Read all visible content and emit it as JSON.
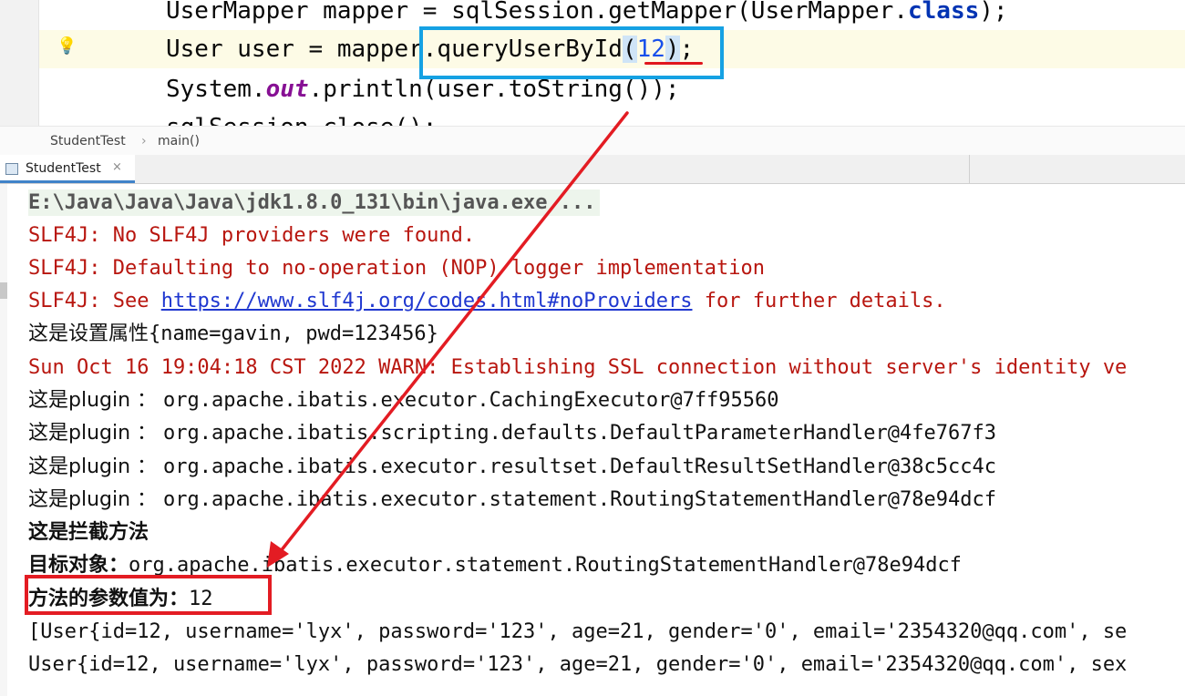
{
  "editor": {
    "line1": {
      "a": "UserMapper mapper = sqlSession.getMapper(UserMapper.",
      "kw": "class",
      "b": ");"
    },
    "line2": {
      "a": "User user = mapper.queryUserById",
      "open": "(",
      "num": "12",
      "close": ")",
      "b": ";"
    },
    "line3": {
      "a": "System.",
      "fld": "out",
      "b": ".println(user.toString());"
    },
    "line4": "sqlSession.close();"
  },
  "breadcrumb": {
    "class_name": "StudentTest",
    "separator": "›",
    "method": "main()"
  },
  "run_tab": {
    "label": "StudentTest",
    "close": "×"
  },
  "console": {
    "command": "E:\\Java\\Java\\Java\\jdk1.8.0_131\\bin\\java.exe ...",
    "slf4j_1": "SLF4J: No SLF4J providers were found.",
    "slf4j_2": "SLF4J: Defaulting to no-operation (NOP) logger implementation",
    "slf4j_3_prefix": "SLF4J: See ",
    "slf4j_3_link": "https://www.slf4j.org/codes.html#noProviders",
    "slf4j_3_suffix": " for further details.",
    "props_cn": "这是设置属性",
    "props_val": "{name=gavin, pwd=123456}",
    "warn": "Sun Oct 16 19:04:18 CST 2022 WARN: Establishing SSL connection without server's identity ve",
    "plugin_prefix": "这是plugin ： ",
    "plugins": [
      "org.apache.ibatis.executor.CachingExecutor@7ff95560",
      "org.apache.ibatis.scripting.defaults.DefaultParameterHandler@4fe767f3",
      "org.apache.ibatis.executor.resultset.DefaultResultSetHandler@38c5cc4c",
      "org.apache.ibatis.executor.statement.RoutingStatementHandler@78e94dcf"
    ],
    "intercept": "这是拦截方法",
    "target_label": "目标对象：",
    "target_val": "org.apache.ibatis.executor.statement.RoutingStatementHandler@78e94dcf",
    "param_label": "方法的参数值为：",
    "param_val": "12",
    "result_list": "[User{id=12, username='lyx', password='123', age=21, gender='0', email='2354320@qq.com', se",
    "result_obj": "User{id=12, username='lyx', password='123', age=21, gender='0', email='2354320@qq.com', sex"
  },
  "colors": {
    "annotation_red": "#e31c23",
    "annotation_blue": "#15a1e3",
    "error_text": "#b8160f",
    "link": "#1f37d0"
  },
  "icons": {
    "bulb": "lightbulb-icon",
    "tab": "console-tab-icon"
  }
}
